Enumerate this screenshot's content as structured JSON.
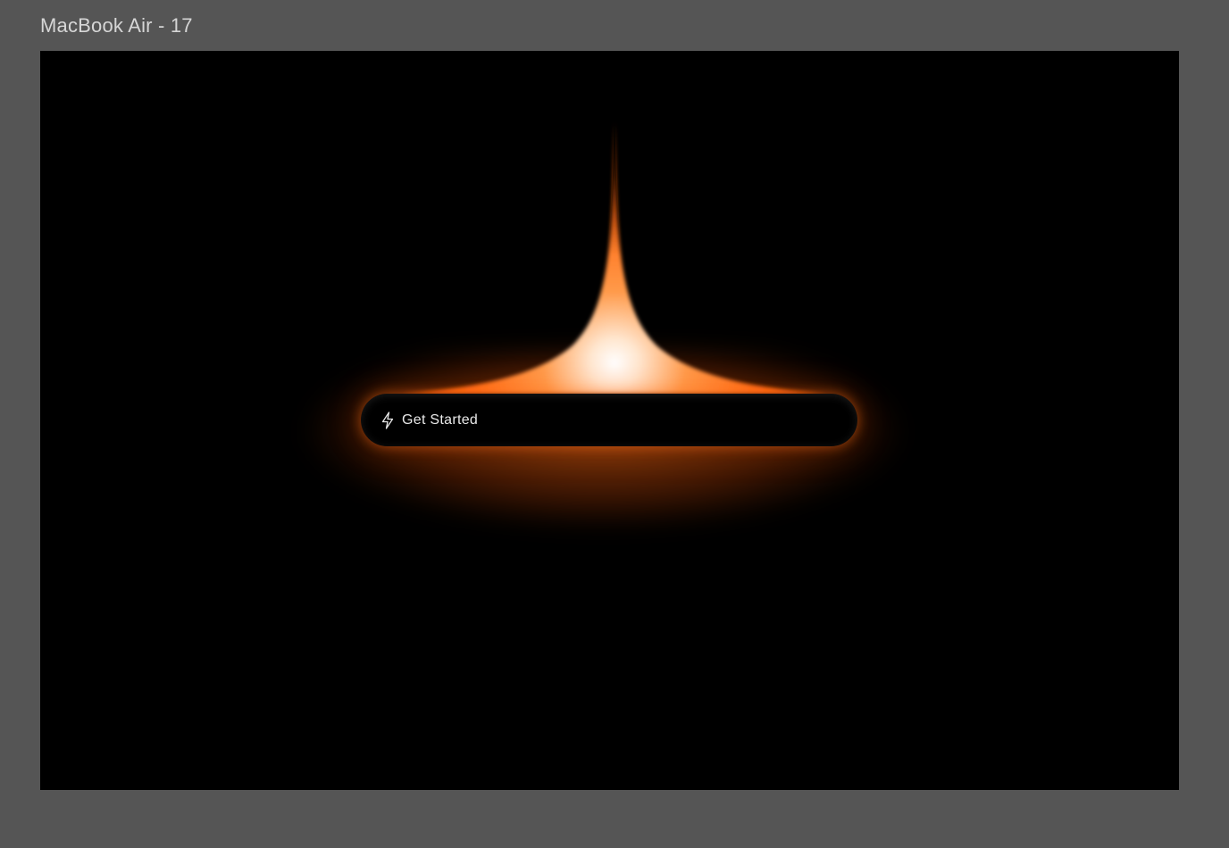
{
  "frame": {
    "title": "MacBook Air - 17"
  },
  "cta": {
    "label": "Get Started",
    "icon": "lightning-bolt-icon"
  },
  "colors": {
    "canvas": "#555555",
    "frame_background": "#000000",
    "glow": "#ff6a14",
    "glow_core": "#ffffff",
    "button_text": "#e9e9e9"
  }
}
